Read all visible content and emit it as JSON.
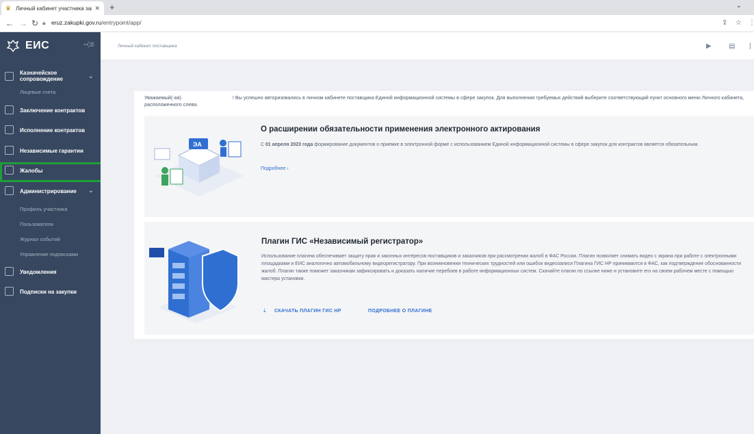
{
  "browser": {
    "tab_title": "Личный кабинет участника зак",
    "url_host": "eruz.zakupki.gov.ru",
    "url_path": "/entrypoint/app/"
  },
  "sidebar": {
    "brand": "ЕИС",
    "items": [
      {
        "label": "Казначейское сопровождение",
        "icon": "wallet-icon",
        "expandable": true
      },
      {
        "label": "Лицевые счета"
      },
      {
        "label": "Заключение контрактов",
        "icon": "contract-sign-icon"
      },
      {
        "label": "Исполнение контрактов",
        "icon": "document-icon"
      },
      {
        "label": "Независимые гарантии",
        "icon": "bank-icon"
      },
      {
        "label": "Жалобы",
        "icon": "complaint-icon"
      },
      {
        "label": "Администрирование",
        "icon": "admin-list-icon",
        "expandable": true
      },
      {
        "label": "Профиль участника"
      },
      {
        "label": "Пользователи"
      },
      {
        "label": "Журнал событий"
      },
      {
        "label": "Управление подписками"
      },
      {
        "label": "Уведомления",
        "icon": "mail-icon"
      },
      {
        "label": "Подписки на закупки",
        "icon": "megaphone-icon"
      }
    ]
  },
  "header": {
    "breadcrumb": "Личный кабинет поставщика"
  },
  "greeting": {
    "text_start": "Уважаемый(-ая)",
    "text_rest": "! Вы успешно авторизовались в личном кабинете поставщика Единой информационной системы в сфере закупок. Для выполнения требуемых действий выберите соответствующий пункт основного меню Личного кабинета, расположенного слева."
  },
  "card1": {
    "title": "О расширении обязательности применения электронного актирования",
    "text_prefix": "С ",
    "text_bold": "01 апреля 2023 года",
    "text_rest": " формирование документов о приемке в электронной форме с использованием Единой информационной системы в сфере закупок для контрактов является обязательным.",
    "more_link": "Подробнее ›",
    "badge": "ЭА"
  },
  "card2": {
    "title": "Плагин ГИС «Независимый регистратор»",
    "text": "Использование плагина обеспечивает защиту прав и законных интересов поставщиков и заказчиков при рассмотрении жалоб в ФАС России. Плагин позволяет снимать видео с экрана при работе с электронными площадками и ЕИС аналогично автомобильному видеорегистратору. При возникновении технических трудностей или ошибок видеозаписи Плагина ГИС НР принимаются в ФАС, как подтверждение обоснованности жалоб. Плагин также поможет заказчикам зафиксировать и доказать наличие перебоев в работе информационных систем. Скачайте плагин по ссылке ниже и установите его на своем рабочем месте с помощью мастера установки.",
    "download_label": "СКАЧАТЬ ПЛАГИН ГИС НР",
    "more_label": "ПОДРОБНЕЕ О ПЛАГИНЕ"
  }
}
